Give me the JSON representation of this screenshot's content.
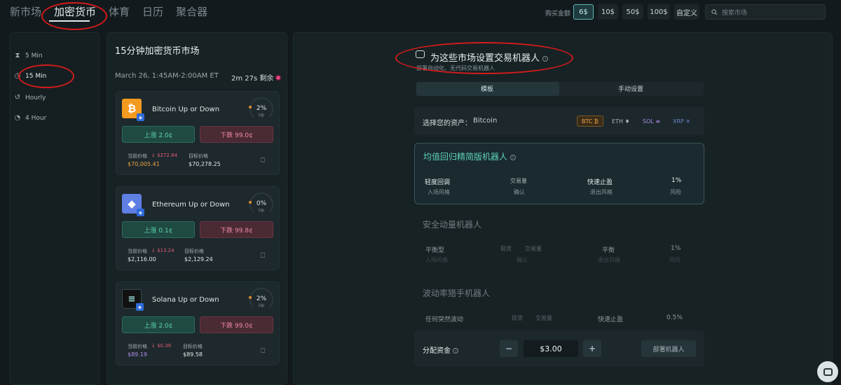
{
  "top_nav": {
    "items": [
      "新市场",
      "加密货币",
      "体育",
      "日历",
      "聚合器"
    ],
    "active": "加密货币"
  },
  "amount_bar": {
    "label": "购买金额",
    "options": [
      "6$",
      "10$",
      "50$",
      "100$",
      "自定义"
    ],
    "selected": "6$"
  },
  "search": {
    "placeholder": "搜索市场"
  },
  "sidebar": {
    "items": [
      {
        "label": "5 Min",
        "icon": "hourglass-icon"
      },
      {
        "label": "15 Min",
        "icon": "stopwatch-icon"
      },
      {
        "label": "Hourly",
        "icon": "history-icon"
      },
      {
        "label": "4 Hour",
        "icon": "clock-icon"
      }
    ],
    "active": "15 Min"
  },
  "market": {
    "title": "15分钟加密货币市场",
    "date_range": "March 26, 1:45AM-2:00AM ET",
    "remaining": "2m 27s 剩余",
    "cards": [
      {
        "name": "Bitcoin Up or Down",
        "coin": "bitcoin-icon",
        "color": "#f39a1f",
        "pct": "2%",
        "up_label": "Up",
        "up_btn": "上涨 2.0¢",
        "down_btn": "下跌 99.0¢",
        "cur_label": "当前价格",
        "change": "↓ $272.84",
        "cur_price": "$70,005.41",
        "cur_color": "#f0a44a",
        "target_label": "目标价格",
        "target_price": "$70,278.25"
      },
      {
        "name": "Ethereum Up or Down",
        "coin": "ethereum-icon",
        "color": "#5f7fe3",
        "pct": "0%",
        "up_label": "Up",
        "up_btn": "上涨 0.1¢",
        "down_btn": "下跌 99.8¢",
        "cur_label": "当前价格",
        "change": "↓ $13.24",
        "cur_price": "$2,116.00",
        "cur_color": "#e2e8ea",
        "target_label": "目标价格",
        "target_price": "$2,129.24"
      },
      {
        "name": "Solana Up or Down",
        "coin": "solana-icon",
        "color": "#111111",
        "pct": "2%",
        "up_label": "Up",
        "up_btn": "上涨 2.0¢",
        "down_btn": "下跌 99.0¢",
        "cur_label": "当前价格",
        "change": "↓ $0.39",
        "cur_price": "$89.19",
        "cur_color": "#b08ce8",
        "target_label": "目标价格",
        "target_price": "$89.58"
      }
    ]
  },
  "bot_panel": {
    "title": "为这些市场设置交易机器人",
    "subtitle": "部署自动化、无代码交易机器人",
    "tabs": [
      "模板",
      "手动设置"
    ],
    "asset_label": "选择您的资产：",
    "asset_value": "Bitcoin",
    "assets": [
      {
        "label": "BTC ₿",
        "color": "#f0a44a",
        "bg": "#3a2c18",
        "border": "#7a5a28"
      },
      {
        "label": "ETH ♦",
        "color": "#aab5b9",
        "bg": "transparent",
        "border": "transparent"
      },
      {
        "label": "SOL ≡",
        "color": "#a88ee8",
        "bg": "transparent",
        "border": "transparent"
      },
      {
        "label": "XRP ✕",
        "color": "#6b86c8",
        "bg": "transparent",
        "border": "transparent"
      }
    ],
    "strategies": [
      {
        "title": "均值回归精简版机器人",
        "cols": [
          {
            "value": "轻度回调",
            "label": "入场风格"
          },
          {
            "value": "交易量",
            "label": "确认"
          },
          {
            "value": "快速止盈",
            "label": "退出风格"
          },
          {
            "value": "1%",
            "label": "风险"
          }
        ]
      },
      {
        "title": "安全动量机器人",
        "cols": [
          {
            "value": "平衡型",
            "label": "入场风格"
          },
          {
            "value": "现货",
            "label": ""
          },
          {
            "value": "交易量",
            "label": "确认"
          },
          {
            "value": "平衡",
            "label": "退出风格"
          },
          {
            "value": "1%",
            "label": "风险"
          }
        ]
      },
      {
        "title": "波动率猎手机器人",
        "cols": [
          {
            "value": "任何突然波动",
            "label": ""
          },
          {
            "value": "现货",
            "label": ""
          },
          {
            "value": "交易量",
            "label": ""
          },
          {
            "value": "快速止盈",
            "label": ""
          },
          {
            "value": "0.5%",
            "label": ""
          }
        ]
      }
    ],
    "allocate_label": "分配资金",
    "minus": "−",
    "plus": "+",
    "amount": "$3.00",
    "deploy": "部署机器人"
  }
}
